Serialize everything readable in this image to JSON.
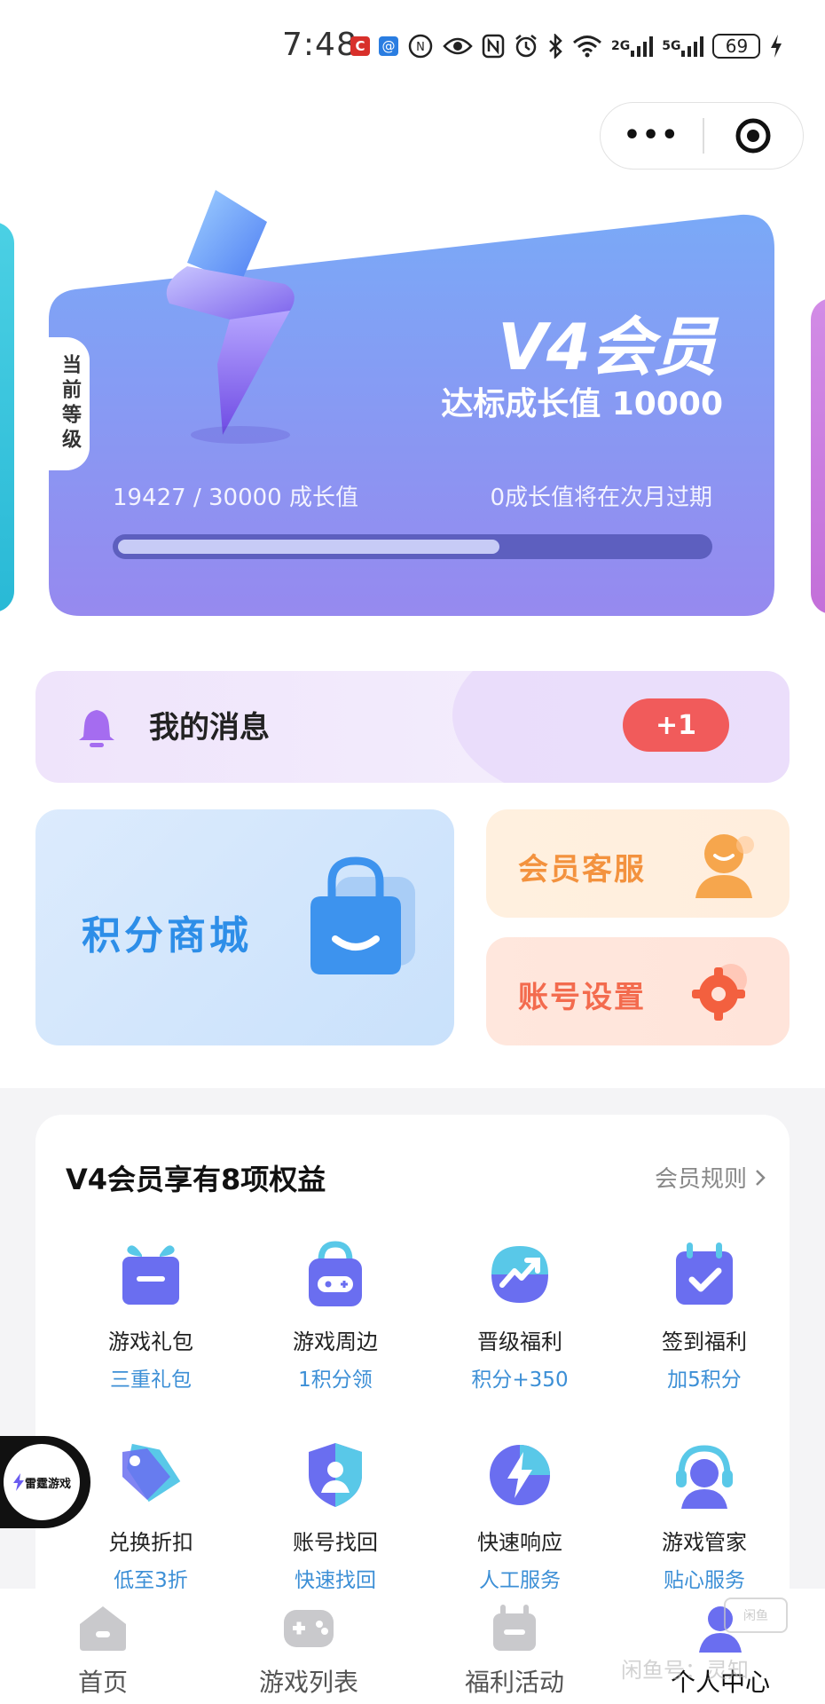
{
  "status_bar": {
    "time": "7:48",
    "app_icon_1": "C",
    "app_icon_2": "@",
    "signal_2g": "2G",
    "signal_5g": "5G",
    "battery": "69"
  },
  "capsule": {
    "more_label": "•••"
  },
  "member_card": {
    "level_tag": "当前等级",
    "title": "V4会员",
    "subtitle": "达标成长值 10000",
    "growth": "19427 / 30000 成长值",
    "expire_note": "0成长值将在次月过期",
    "progress_value": 19427,
    "progress_max": 30000,
    "gradient_top": "#7aa9f7",
    "gradient_bottom": "#9689ef"
  },
  "messages": {
    "label": "我的消息",
    "badge": "+1"
  },
  "shortcuts": {
    "mall": "积分商城",
    "service": "会员客服",
    "account": "账号设置"
  },
  "benefits": {
    "title": "V4会员享有8项权益",
    "rules_link": "会员规则",
    "items": [
      {
        "name": "游戏礼包",
        "sub": "三重礼包",
        "icon": "gift-icon"
      },
      {
        "name": "游戏周边",
        "sub": "1积分领",
        "icon": "merch-bag-icon"
      },
      {
        "name": "晋级福利",
        "sub": "积分+350",
        "icon": "level-up-icon"
      },
      {
        "name": "签到福利",
        "sub": "加5积分",
        "icon": "calendar-check-icon"
      },
      {
        "name": "兑换折扣",
        "sub": "低至3折",
        "icon": "discount-tag-icon"
      },
      {
        "name": "账号找回",
        "sub": "快速找回",
        "icon": "shield-user-icon"
      },
      {
        "name": "快速响应",
        "sub": "人工服务",
        "icon": "lightning-icon"
      },
      {
        "name": "游戏管家",
        "sub": "贴心服务",
        "icon": "headset-icon"
      }
    ]
  },
  "float_badge": {
    "label": "雷霆游戏"
  },
  "tabbar": {
    "tabs": [
      {
        "label": "首页",
        "icon": "home-icon"
      },
      {
        "label": "游戏列表",
        "icon": "gamepad-icon"
      },
      {
        "label": "福利活动",
        "icon": "gift-box-icon"
      },
      {
        "label": "个人中心",
        "icon": "user-icon"
      }
    ]
  },
  "watermark": {
    "text": "闲鱼号：灵知",
    "box": "闲鱼"
  },
  "colors": {
    "accent_blue": "#3c8fd6",
    "badge_red": "#f15b5b",
    "service_orange": "#f3923e",
    "account_coral": "#f36b4e",
    "mall_blue": "#2d8ee8"
  }
}
